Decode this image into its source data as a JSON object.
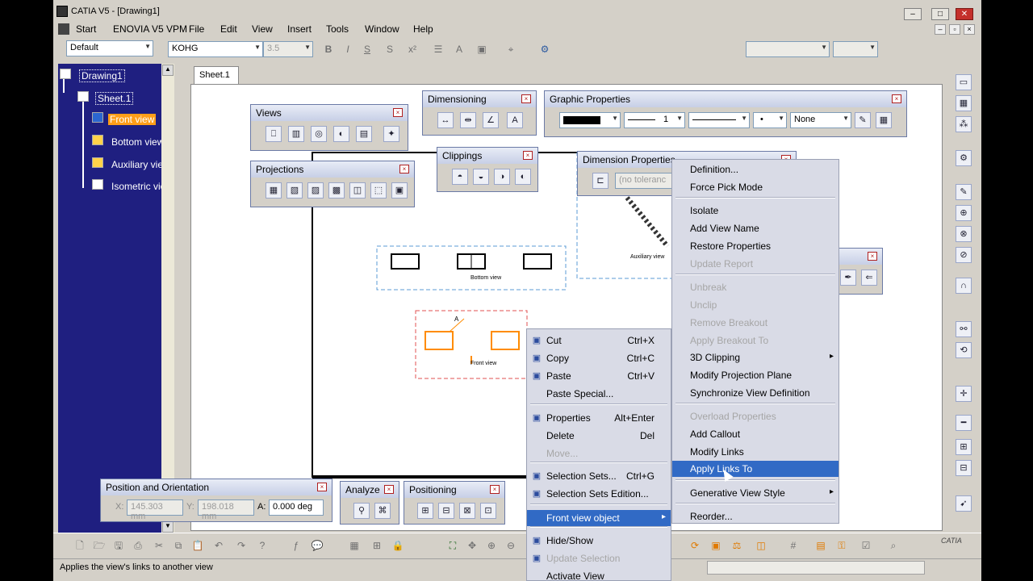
{
  "window": {
    "title": "CATIA V5 - [Drawing1]",
    "min": "–",
    "restore": "□",
    "close": "✕"
  },
  "menubar": [
    "Start",
    "ENOVIA V5 VPM",
    "File",
    "Edit",
    "View",
    "Insert",
    "Tools",
    "Window",
    "Help"
  ],
  "format_toolbar": {
    "style": "Default",
    "font": "KOHG",
    "size": "3.5",
    "bold": "B",
    "italic": "I",
    "underline": "S"
  },
  "tree": {
    "root": "Drawing1",
    "sheet": "Sheet.1",
    "views": [
      "Front view",
      "Bottom view",
      "Auxiliary view",
      "Isometric view"
    ]
  },
  "tab": "Sheet.1",
  "toolbars": {
    "views": "Views",
    "projections": "Projections",
    "dimensioning": "Dimensioning",
    "clippings": "Clippings",
    "graphic_properties": "Graphic Properties",
    "dimension_properties": "Dimension Properties",
    "position_orientation": "Position and Orientation",
    "analyze": "Analyze",
    "positioning": "Positioning",
    "gp_linewidth": "1",
    "gp_pattern": "None",
    "dp_tolerance": "(no toleranc",
    "pos_x_label": "X:",
    "pos_x": "145.303 mm",
    "pos_y_label": "Y:",
    "pos_y": "198.018 mm",
    "pos_a_label": "A:",
    "pos_a": "0.000 deg"
  },
  "canvas_labels": {
    "bottom_view": "Bottom view",
    "aux_view": "Auxiliary view",
    "front_view": "Front view",
    "section_a": "A"
  },
  "context_menu": [
    {
      "label": "Cut",
      "shortcut": "Ctrl+X",
      "icon": "cut-icon",
      "state": "normal"
    },
    {
      "label": "Copy",
      "shortcut": "Ctrl+C",
      "icon": "copy-icon",
      "state": "normal"
    },
    {
      "label": "Paste",
      "shortcut": "Ctrl+V",
      "icon": "paste-icon",
      "state": "normal"
    },
    {
      "label": "Paste Special...",
      "shortcut": "",
      "icon": "",
      "state": "normal"
    },
    {
      "label": "Properties",
      "shortcut": "Alt+Enter",
      "icon": "properties-icon",
      "state": "normal"
    },
    {
      "label": "Delete",
      "shortcut": "Del",
      "icon": "",
      "state": "normal"
    },
    {
      "label": "Move...",
      "shortcut": "",
      "icon": "",
      "state": "disabled"
    },
    {
      "label": "Selection Sets...",
      "shortcut": "Ctrl+G",
      "icon": "selection-sets-icon",
      "state": "normal"
    },
    {
      "label": "Selection Sets Edition...",
      "shortcut": "",
      "icon": "selection-edit-icon",
      "state": "normal"
    },
    {
      "label": "Front view object",
      "shortcut": "",
      "icon": "",
      "state": "active"
    },
    {
      "label": "Hide/Show",
      "shortcut": "",
      "icon": "hide-show-icon",
      "state": "normal"
    },
    {
      "label": "Update Selection",
      "shortcut": "",
      "icon": "update-icon",
      "state": "disabled"
    },
    {
      "label": "Activate View",
      "shortcut": "",
      "icon": "",
      "state": "normal"
    }
  ],
  "submenu": [
    {
      "label": "Definition...",
      "state": "normal"
    },
    {
      "label": "Force Pick Mode",
      "state": "normal"
    },
    {
      "label": "Isolate",
      "state": "normal"
    },
    {
      "label": "Add View Name",
      "state": "normal"
    },
    {
      "label": "Restore Properties",
      "state": "normal"
    },
    {
      "label": "Update Report",
      "state": "disabled"
    },
    {
      "label": "Unbreak",
      "state": "disabled"
    },
    {
      "label": "Unclip",
      "state": "disabled"
    },
    {
      "label": "Remove Breakout",
      "state": "disabled"
    },
    {
      "label": "Apply Breakout To",
      "state": "disabled"
    },
    {
      "label": "3D Clipping",
      "state": "sub"
    },
    {
      "label": "Modify Projection Plane",
      "state": "normal"
    },
    {
      "label": "Synchronize View Definition",
      "state": "normal"
    },
    {
      "label": "Overload Properties",
      "state": "disabled"
    },
    {
      "label": "Add Callout",
      "state": "normal"
    },
    {
      "label": "Modify Links",
      "state": "normal"
    },
    {
      "label": "Apply Links To",
      "state": "active"
    },
    {
      "label": "Generative View Style",
      "state": "sub"
    },
    {
      "label": "Reorder...",
      "state": "normal"
    }
  ],
  "status": {
    "message": "Applies the view's links to another view"
  },
  "colors": {
    "tree_bg": "#1f1f80",
    "highlight": "#316ac5",
    "front_view_highlight": "#ff9e19"
  }
}
